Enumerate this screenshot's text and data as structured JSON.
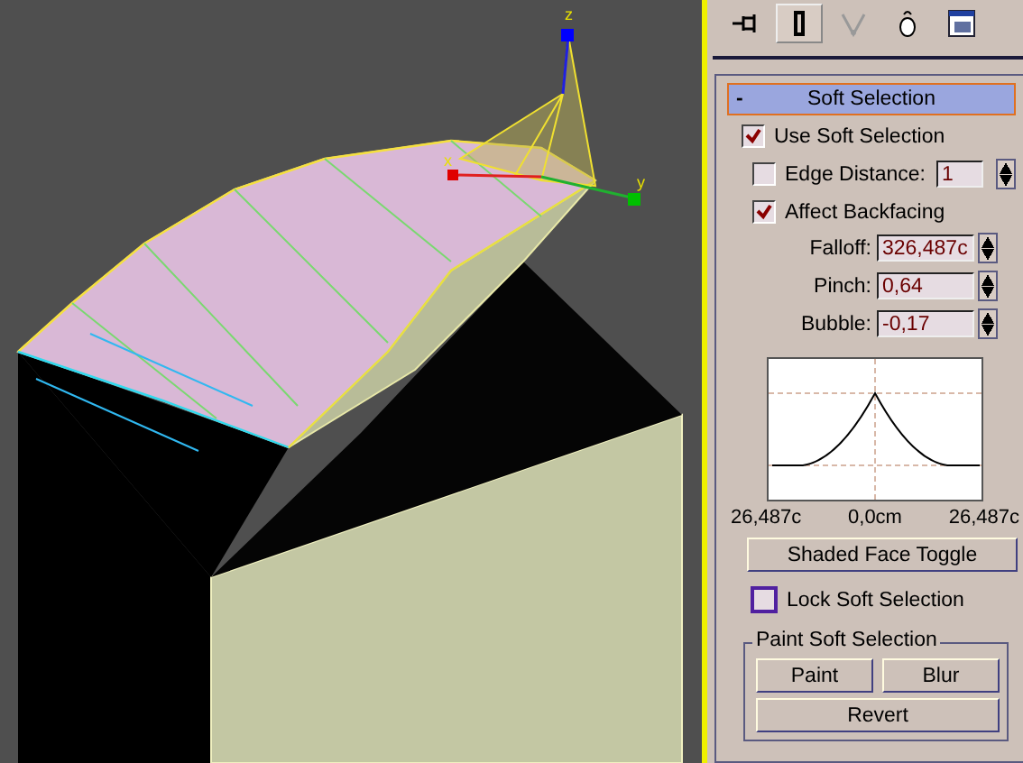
{
  "viewport": {
    "axis_labels": [
      "z",
      "x",
      "y"
    ]
  },
  "command_tabs": [
    {
      "selected": false
    },
    {
      "selected": true
    },
    {
      "selected": false
    },
    {
      "selected": false
    },
    {
      "selected": false
    }
  ],
  "rollout": {
    "collapse_sign": "-",
    "title": "Soft Selection",
    "checkboxes": [
      {
        "label": "Use Soft Selection",
        "checked": true
      },
      {
        "label": "Edge Distance:",
        "checked": false,
        "spinner": "1"
      },
      {
        "label": "Affect Backfacing",
        "checked": true
      }
    ],
    "spinners": [
      {
        "label": "Falloff:",
        "value": "326,487c"
      },
      {
        "label": "Pinch:",
        "value": "0,64"
      },
      {
        "label": "Bubble:",
        "value": "-0,17"
      }
    ],
    "graph_labels": [
      "26,487c",
      "0,0cm",
      "26,487c"
    ],
    "shaded_button": "Shaded Face Toggle",
    "lock": {
      "label": "Lock Soft Selection",
      "checked": false
    },
    "paint_group": {
      "title": "Paint Soft Selection",
      "buttons": [
        "Paint",
        "Blur"
      ],
      "revert": "Revert"
    }
  }
}
